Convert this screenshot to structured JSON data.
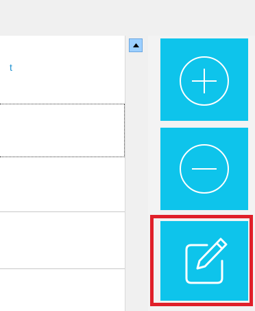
{
  "list": {
    "first_row_text": "t"
  },
  "colors": {
    "tile": "#0ec4eb",
    "highlight": "#e0202a",
    "link": "#1a8fd0"
  },
  "buttons": {
    "add": {
      "icon": "plus-circle-icon"
    },
    "remove": {
      "icon": "minus-circle-icon"
    },
    "edit": {
      "icon": "edit-pencil-icon",
      "highlighted": true
    }
  }
}
